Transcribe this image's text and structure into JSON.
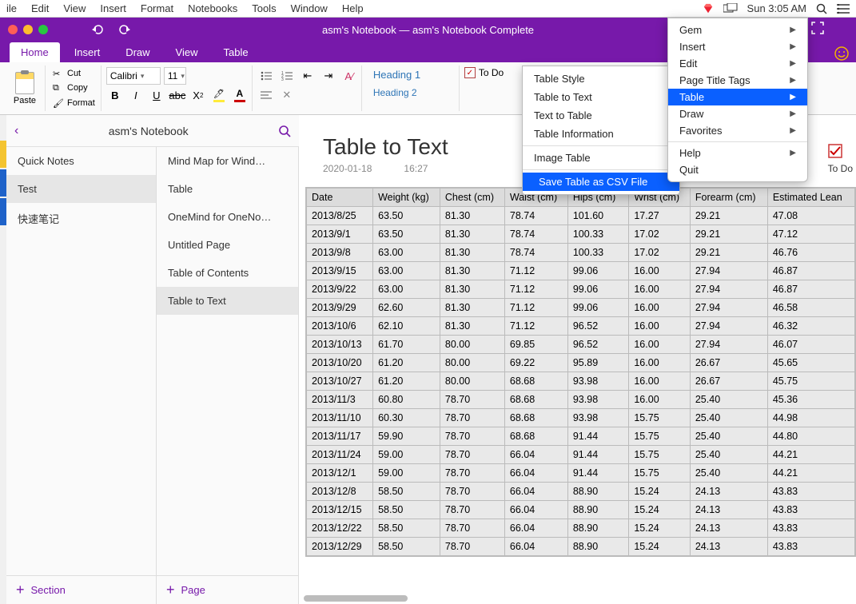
{
  "mac_menu": {
    "items": [
      "ile",
      "Edit",
      "View",
      "Insert",
      "Format",
      "Notebooks",
      "Tools",
      "Window",
      "Help"
    ],
    "time": "Sun 3:05 AM"
  },
  "titlebar": {
    "title": "asm's Notebook — asm's Notebook Complete"
  },
  "ribbon_tabs": [
    "Home",
    "Insert",
    "Draw",
    "View",
    "Table"
  ],
  "ribbon": {
    "paste": "Paste",
    "cut": "Cut",
    "copy": "Copy",
    "format": "Format",
    "font_name": "Calibri",
    "font_size": "11",
    "style1": "Heading 1",
    "style2": "Heading 2",
    "todo": "To Do",
    "todo2": "To Do"
  },
  "nb": {
    "title": "asm's Notebook"
  },
  "sections": [
    "Quick Notes",
    "Test",
    "快速笔记"
  ],
  "pages": [
    "Mind Map for Wind…",
    "Table",
    "OneMind for OneNo…",
    "Untitled Page",
    "Table of Contents",
    "Table to Text"
  ],
  "footer": {
    "section": "Section",
    "page": "Page"
  },
  "page": {
    "title": "Table to Text",
    "date": "2020-01-18",
    "time": "16:27"
  },
  "gem_submenu": {
    "items": [
      "Table Style",
      "Table to Text",
      "Text to Table",
      "Table Information"
    ],
    "sep1": true,
    "img_table": "Image Table",
    "sep2": true,
    "save_csv": "Save Table as CSV File"
  },
  "app_menu": {
    "items": [
      {
        "label": "Gem",
        "arrow": true
      },
      {
        "label": "Insert",
        "arrow": true
      },
      {
        "label": "Edit",
        "arrow": true
      },
      {
        "label": "Page Title Tags",
        "arrow": true
      },
      {
        "label": "Table",
        "arrow": true,
        "hl": true
      },
      {
        "label": "Draw",
        "arrow": true
      },
      {
        "label": "Favorites",
        "arrow": true
      },
      {
        "label": "-"
      },
      {
        "label": "Help",
        "arrow": true
      },
      {
        "label": "Quit",
        "arrow": false
      }
    ]
  },
  "table": {
    "headers": [
      "Date",
      "Weight (kg)",
      "Chest (cm)",
      "Waist (cm)",
      "Hips (cm)",
      "Wrist (cm)",
      "Forearm (cm)",
      "Estimated Lean"
    ],
    "rows": [
      [
        "2013/8/25",
        "63.50",
        "81.30",
        "78.74",
        "101.60",
        "17.27",
        "29.21",
        "47.08"
      ],
      [
        "2013/9/1",
        "63.50",
        "81.30",
        "78.74",
        "100.33",
        "17.02",
        "29.21",
        "47.12"
      ],
      [
        "2013/9/8",
        "63.00",
        "81.30",
        "78.74",
        "100.33",
        "17.02",
        "29.21",
        "46.76"
      ],
      [
        "2013/9/15",
        "63.00",
        "81.30",
        "71.12",
        "99.06",
        "16.00",
        "27.94",
        "46.87"
      ],
      [
        "2013/9/22",
        "63.00",
        "81.30",
        "71.12",
        "99.06",
        "16.00",
        "27.94",
        "46.87"
      ],
      [
        "2013/9/29",
        "62.60",
        "81.30",
        "71.12",
        "99.06",
        "16.00",
        "27.94",
        "46.58"
      ],
      [
        "2013/10/6",
        "62.10",
        "81.30",
        "71.12",
        "96.52",
        "16.00",
        "27.94",
        "46.32"
      ],
      [
        "2013/10/13",
        "61.70",
        "80.00",
        "69.85",
        "96.52",
        "16.00",
        "27.94",
        "46.07"
      ],
      [
        "2013/10/20",
        "61.20",
        "80.00",
        "69.22",
        "95.89",
        "16.00",
        "26.67",
        "45.65"
      ],
      [
        "2013/10/27",
        "61.20",
        "80.00",
        "68.68",
        "93.98",
        "16.00",
        "26.67",
        "45.75"
      ],
      [
        "2013/11/3",
        "60.80",
        "78.70",
        "68.68",
        "93.98",
        "16.00",
        "25.40",
        "45.36"
      ],
      [
        "2013/11/10",
        "60.30",
        "78.70",
        "68.68",
        "93.98",
        "15.75",
        "25.40",
        "44.98"
      ],
      [
        "2013/11/17",
        "59.90",
        "78.70",
        "68.68",
        "91.44",
        "15.75",
        "25.40",
        "44.80"
      ],
      [
        "2013/11/24",
        "59.00",
        "78.70",
        "66.04",
        "91.44",
        "15.75",
        "25.40",
        "44.21"
      ],
      [
        "2013/12/1",
        "59.00",
        "78.70",
        "66.04",
        "91.44",
        "15.75",
        "25.40",
        "44.21"
      ],
      [
        "2013/12/8",
        "58.50",
        "78.70",
        "66.04",
        "88.90",
        "15.24",
        "24.13",
        "43.83"
      ],
      [
        "2013/12/15",
        "58.50",
        "78.70",
        "66.04",
        "88.90",
        "15.24",
        "24.13",
        "43.83"
      ],
      [
        "2013/12/22",
        "58.50",
        "78.70",
        "66.04",
        "88.90",
        "15.24",
        "24.13",
        "43.83"
      ],
      [
        "2013/12/29",
        "58.50",
        "78.70",
        "66.04",
        "88.90",
        "15.24",
        "24.13",
        "43.83"
      ]
    ]
  }
}
